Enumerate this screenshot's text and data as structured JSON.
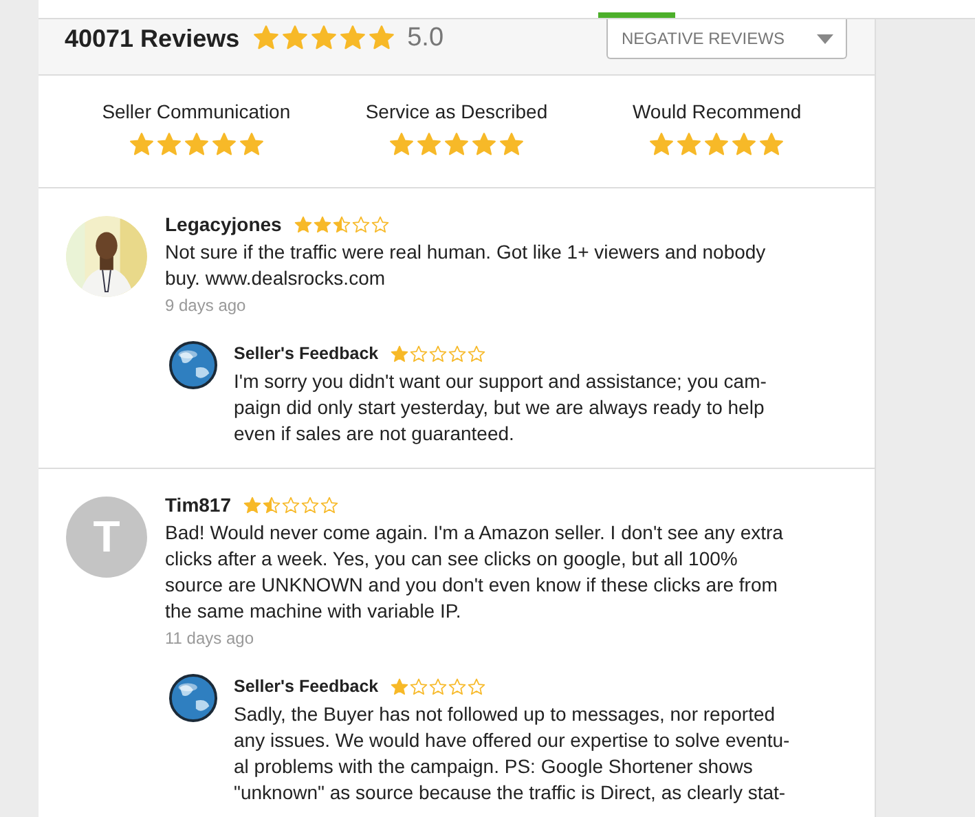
{
  "summary": {
    "title": "40071 Reviews",
    "stars": 5,
    "score": "5.0"
  },
  "filter": {
    "value": "NEGATIVE REVIEWS"
  },
  "ratings": [
    {
      "label": "Seller Communication",
      "stars": 5
    },
    {
      "label": "Service as Described",
      "stars": 5
    },
    {
      "label": "Would Recommend",
      "stars": 5
    }
  ],
  "reviews": [
    {
      "author": "Legacyjones",
      "stars": 2.5,
      "text": "Not sure if the traffic were real human. Got like 1+ viewers and nobody buy. www.dealsrocks.com",
      "time": "9 days ago",
      "feedback": {
        "title": "Seller's Feedback",
        "stars": 1,
        "text": "I'm sorry you didn't want our support and assistance; you cam-paign did only start yesterday, but we are always ready to help even if sales are not guaranteed."
      }
    },
    {
      "author": "Tim817",
      "stars": 1.5,
      "avatar": {
        "kind": "initial",
        "letter": "T"
      },
      "text": "Bad! Would never come again. I'm a Amazon seller. I don't see any extra clicks after a week. Yes, you can see clicks on google, but all 100% source are UNKNOWN and you don't even know if these clicks are from the same machine with variable IP.",
      "time": "11 days ago",
      "feedback": {
        "title": "Seller's Feedback",
        "stars": 1,
        "text": "Sadly, the Buyer has not followed up to messages, nor reported any issues. We would have offered our expertise to solve eventu-al problems with the campaign. PS: Google Shortener shows \"unknown\" as source because the traffic is Direct, as clearly stat-"
      }
    }
  ]
}
